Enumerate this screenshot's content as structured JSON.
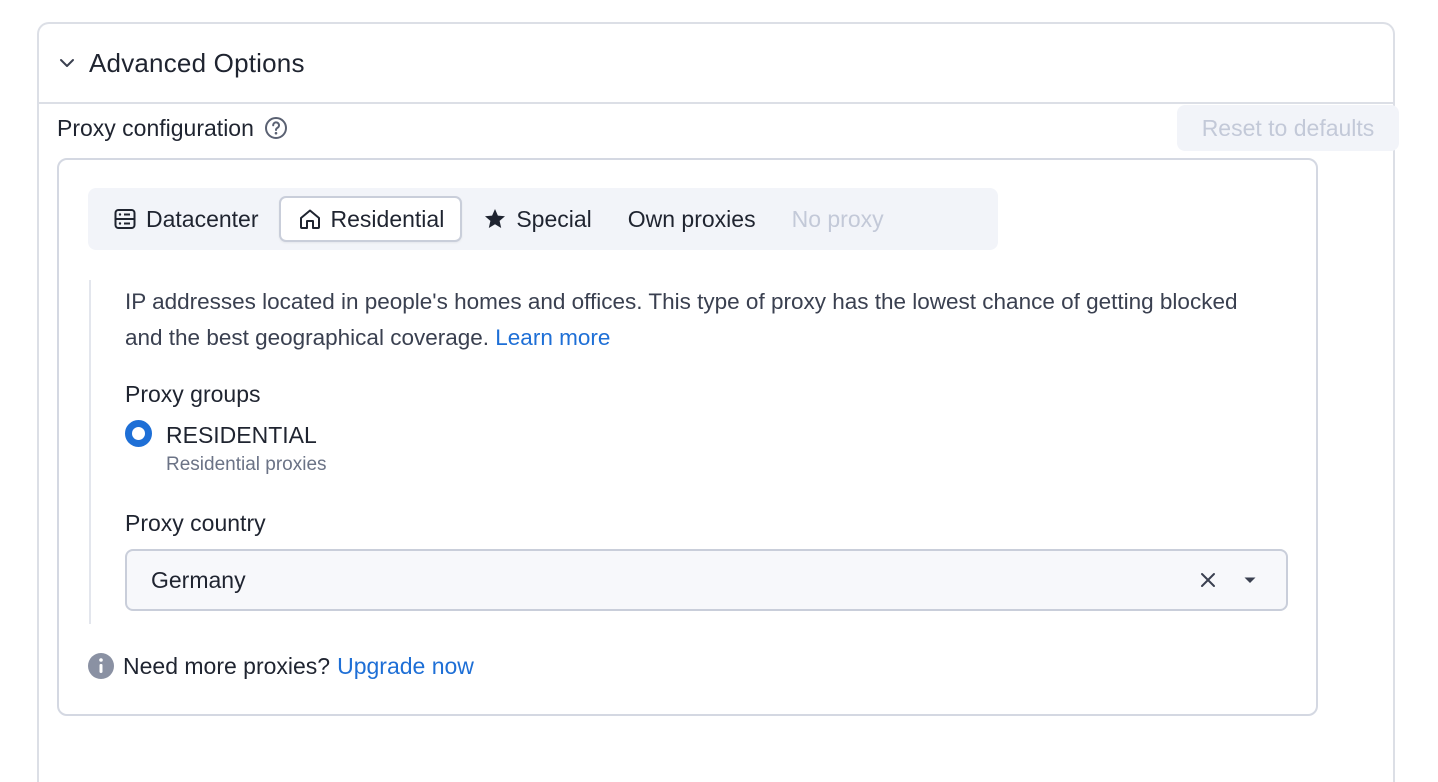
{
  "panel": {
    "title": "Advanced Options",
    "chevron_icon": "chevron-down-icon"
  },
  "proxy": {
    "label": "Proxy configuration",
    "help_icon": "help-circle-icon",
    "reset_label": "Reset to defaults",
    "tabs": [
      {
        "label": "Datacenter",
        "icon": "server-icon",
        "state": "normal"
      },
      {
        "label": "Residential",
        "icon": "home-icon",
        "state": "active"
      },
      {
        "label": "Special",
        "icon": "star-icon",
        "state": "normal"
      },
      {
        "label": "Own proxies",
        "icon": "",
        "state": "normal"
      },
      {
        "label": "No proxy",
        "icon": "",
        "state": "disabled"
      }
    ],
    "description": "IP addresses located in people's homes and offices. This type of proxy has the lowest chance of getting blocked and the best geographical coverage.",
    "learn_more": "Learn more",
    "groups_title": "Proxy groups",
    "group_option": {
      "label": "RESIDENTIAL",
      "sublabel": "Residential proxies",
      "selected": true
    },
    "country_title": "Proxy country",
    "country_value": "Germany",
    "footer_text": "Need more proxies?",
    "upgrade_link": "Upgrade now"
  },
  "colors": {
    "accent": "#1e6fd6",
    "border": "#dcdfe6",
    "disabled_text": "#c3c9d8",
    "tab_bg": "#f2f4f9"
  }
}
